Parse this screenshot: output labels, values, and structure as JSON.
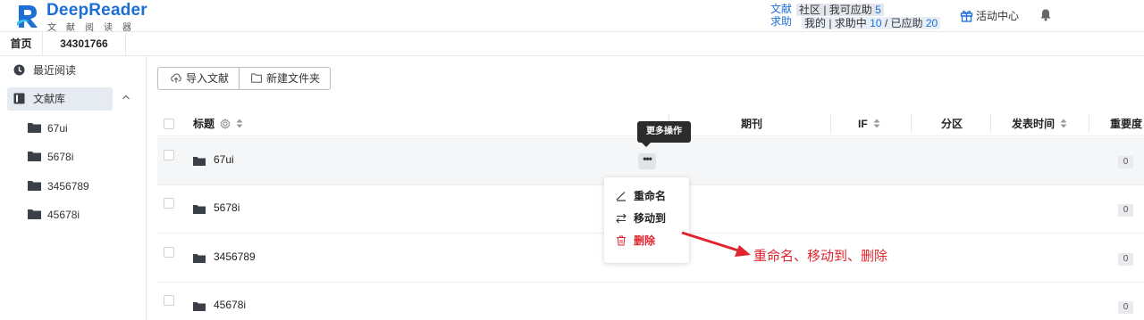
{
  "brand": {
    "name": "DeepReader",
    "subtitle": "文献阅读器"
  },
  "header": {
    "help_label": "文献求助",
    "community_text": "社区 | 我可应助",
    "community_count": "5",
    "mine_text": "我的 | 求助中",
    "pending_count": "10",
    "answered_text": "/ 已应助",
    "answered_count": "20",
    "activity_label": "活动中心"
  },
  "tabs": [
    {
      "label": "首页"
    },
    {
      "label": "34301766"
    }
  ],
  "sidebar": {
    "recent_label": "最近阅读",
    "library_label": "文献库",
    "folders": [
      {
        "label": "67ui"
      },
      {
        "label": "5678i"
      },
      {
        "label": "3456789"
      },
      {
        "label": "45678i"
      }
    ]
  },
  "toolbar": {
    "import_label": "导入文献",
    "new_folder_label": "新建文件夹"
  },
  "table": {
    "headers": {
      "title": "标题",
      "journal": "期刊",
      "if": "IF",
      "partition": "分区",
      "published": "发表时间",
      "importance": "重要度"
    },
    "rows": [
      {
        "name": "67ui",
        "importance": "0"
      },
      {
        "name": "5678i",
        "importance": "0"
      },
      {
        "name": "3456789",
        "importance": "0"
      },
      {
        "name": "45678i",
        "importance": "0"
      }
    ]
  },
  "more_button": {
    "label": "•••",
    "tooltip": "更多操作"
  },
  "context_menu": {
    "rename": "重命名",
    "move": "移动到",
    "delete": "删除"
  },
  "annotation": {
    "text": "重命名、移动到、删除",
    "color": "#e0232c"
  },
  "colors": {
    "brand_blue": "#1c6fd6",
    "danger": "#e0232c"
  }
}
